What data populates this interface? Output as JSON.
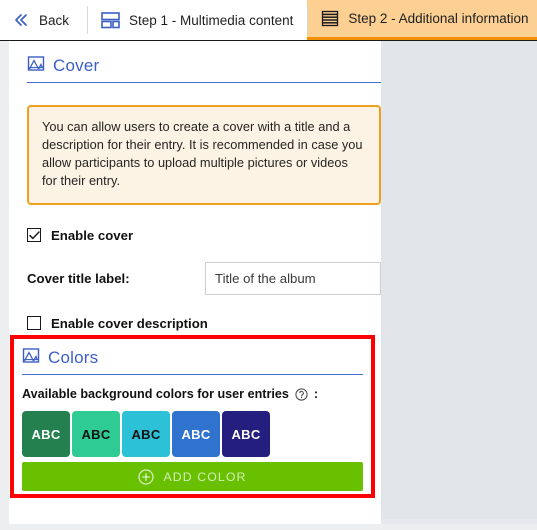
{
  "topbar": {
    "back_label": "Back",
    "back_icon": "chevron-double-left-icon",
    "tabs": [
      {
        "label": "Step 1 - Multimedia content",
        "icon": "layout-grid-icon",
        "active": false
      },
      {
        "label": "Step 2 - Additional information",
        "icon": "list-lines-icon",
        "active": true
      }
    ]
  },
  "cover_section": {
    "title": "Cover",
    "icon": "image-icon",
    "info_text": "You can allow users to create a cover with a title and a description for their entry. It is recommended in case you allow participants to upload multiple pictures or videos for their entry.",
    "enable_cover_label": "Enable cover",
    "enable_cover_checked": true,
    "cover_title_label": "Cover title label:",
    "cover_title_value": "Title of the album",
    "cover_title_placeholder": "Title of the album",
    "enable_description_label": "Enable cover description",
    "enable_description_checked": false
  },
  "colors_section": {
    "title": "Colors",
    "icon": "image-icon",
    "available_label": "Available background colors for user entries",
    "help_icon": "question-circle-icon",
    "colon": ":",
    "swatches": [
      {
        "label": "ABC",
        "bg": "#24814f",
        "fg": "#ffffff"
      },
      {
        "label": "ABC",
        "bg": "#2ecc94",
        "fg": "#111111"
      },
      {
        "label": "ABC",
        "bg": "#2dc1d8",
        "fg": "#111111"
      },
      {
        "label": "ABC",
        "bg": "#3073ce",
        "fg": "#ffffff"
      },
      {
        "label": "ABC",
        "bg": "#241e7e",
        "fg": "#ffffff"
      }
    ],
    "add_color_label": "ADD COLOR",
    "add_color_icon": "plus-circle-icon",
    "add_color_bg": "#68c000",
    "highlight_color": "#ff0000"
  },
  "theme": {
    "accent_blue": "#3b5fc4",
    "active_tab_bg": "#fcd093",
    "active_tab_border": "#f39200",
    "info_border": "#f0a020",
    "info_bg": "#fdf3e4"
  }
}
